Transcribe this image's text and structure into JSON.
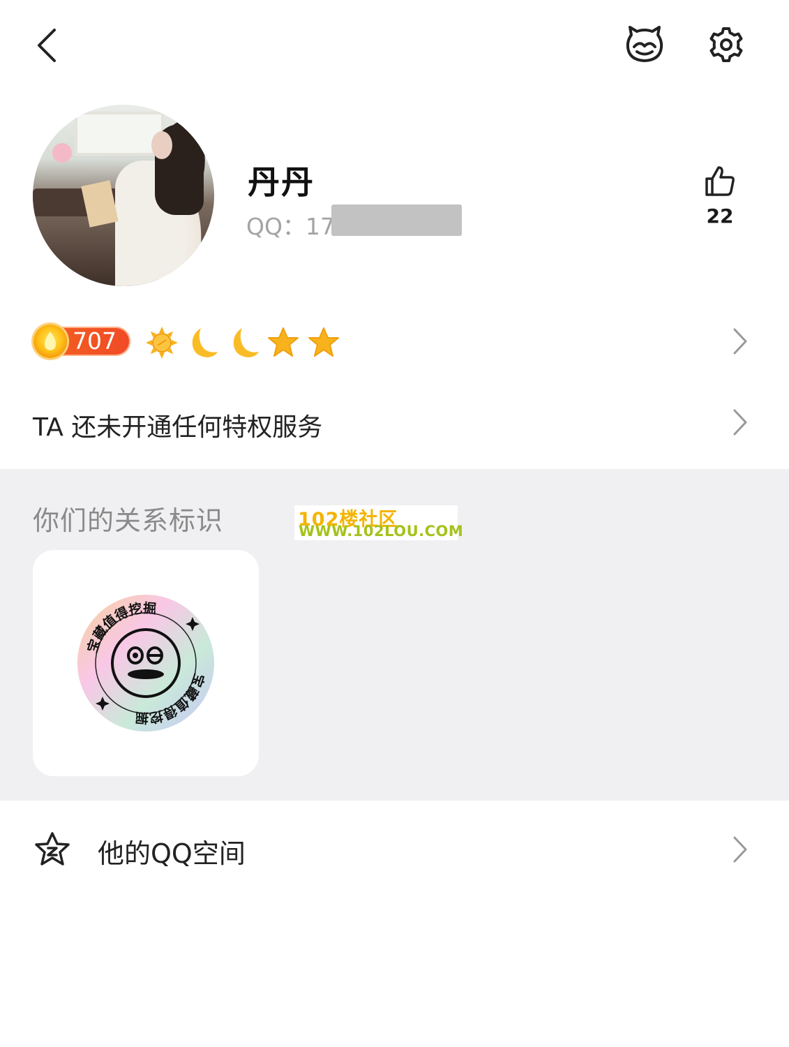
{
  "header": {
    "back_icon": "chevron-left-icon",
    "pet_icon": "cat-face-icon",
    "settings_icon": "gear-icon"
  },
  "profile": {
    "name": "丹丹",
    "qq_label": "QQ：17",
    "like_icon": "thumbs-up-icon",
    "like_count": "22"
  },
  "level": {
    "value": "707",
    "badges": [
      "sun-icon",
      "moon-icon",
      "moon-icon",
      "star-icon",
      "star-icon"
    ]
  },
  "privilege": {
    "text": "TA 还未开通任何特权服务"
  },
  "relationship": {
    "title": "你们的关系标识",
    "badge_text_top": "宝藏值得挖掘",
    "badge_text_bottom": "宝藏值得挖掘"
  },
  "watermark": {
    "line1": "102楼社区",
    "line2": "WWW.102LOU.COM"
  },
  "qzone": {
    "label": "他的QQ空间",
    "icon": "qzone-star-icon"
  },
  "colors": {
    "level_badge": "#f04a26",
    "grey_bg": "#f0f0f2",
    "star": "#f7b21a"
  }
}
